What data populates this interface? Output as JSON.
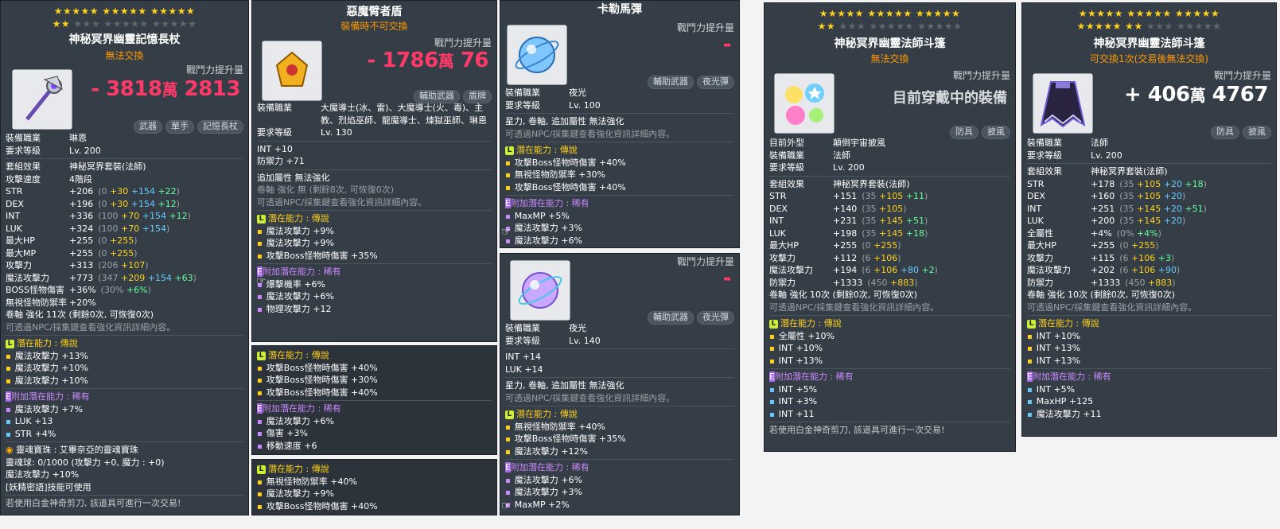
{
  "cp_label": "戰鬥力提升量",
  "p1": {
    "stars_row1": "★★★★★ ★★★★★ ★★★★★",
    "stars_row2_on": "★★",
    "stars_row2_off": "★★★ ★★★★★ ★★★★★",
    "title": "神秘冥界幽靈記憶長杖",
    "sub": "無法交換",
    "cp": "- 3818",
    "cp_wan": "萬",
    "cp_rest": "2813",
    "tags": [
      "武器",
      "單手",
      "記憶長杖"
    ],
    "job_label": "裝備職業",
    "job": "琳恩",
    "req_label": "要求等級",
    "req": "Lv. 200",
    "set_label": "套組效果",
    "set": "神秘冥界套裝(法師)",
    "speed_label": "攻擊速度",
    "speed": "4階段",
    "stats": [
      {
        "k": "STR",
        "v": "+206",
        "b": "(0 ",
        "y": "+30",
        "c": " +154",
        "g": " +22",
        "e": ")"
      },
      {
        "k": "DEX",
        "v": "+196",
        "b": "(0 ",
        "y": "+30",
        "c": " +154",
        "g": " +12",
        "e": ")"
      },
      {
        "k": "INT",
        "v": "+336",
        "b": "(100 ",
        "y": "+70",
        "c": " +154",
        "g": " +12",
        "e": ")"
      },
      {
        "k": "LUK",
        "v": "+324",
        "b": "(100 ",
        "y": "+70",
        "c": " +154",
        "g": "",
        "e": ")"
      },
      {
        "k": "最大HP",
        "v": "+255",
        "b": "(0 ",
        "y": "+255",
        "c": "",
        "g": "",
        "e": ")"
      },
      {
        "k": "最大MP",
        "v": "+255",
        "b": "(0 ",
        "y": "+255",
        "c": "",
        "g": "",
        "e": ")"
      },
      {
        "k": "攻擊力",
        "v": "+313",
        "b": "(206 ",
        "y": "+107",
        "c": "",
        "g": "",
        "e": ")"
      },
      {
        "k": "魔法攻擊力",
        "v": "+773",
        "b": "(347 ",
        "y": "+209",
        "c": " +154",
        "g": " +63",
        "e": ")"
      },
      {
        "k": "BOSS怪物傷害",
        "v": "+36%",
        "b": "(30% ",
        "y": "",
        "c": "",
        "g": "+6%",
        "e": ")"
      },
      {
        "k": "無視怪物防禦率",
        "v": "+20%",
        "b": "",
        "y": "",
        "c": "",
        "g": "",
        "e": ""
      }
    ],
    "scroll": "卷軸 強化 11次 (剩餘0次, 可恢復0次)",
    "npc": "可透過NPC/採集鍵查看強化資訊詳細內容。",
    "pot_title": "潛在能力 : 傳說",
    "pot": [
      "魔法攻擊力 +13%",
      "魔法攻擊力 +10%",
      "魔法攻擊力 +10%"
    ],
    "bonus_title": "附加潛在能力 : 稀有",
    "bonus": [
      "魔法攻擊力 +7%",
      "LUK +13",
      "STR +4%"
    ],
    "soul": "靈魂寶珠 : 艾畢奈亞的靈魂寶珠",
    "soul2": "靈魂球: 0/1000 (攻擊力 +0, 魔力 : +0)",
    "soul3": "魔法攻擊力 +10%",
    "soul4": "[妖精密語]技能可使用",
    "footer": "若使用白金神奇剪刀, 該道具可進行一次交易!"
  },
  "p2": {
    "title": "惡魔臂者盾",
    "sub": "裝備時不可交換",
    "cp": "- 1786",
    "cp_wan": "萬",
    "cp_rest": "76",
    "tags": [
      "輔助武器",
      "盾牌"
    ],
    "job_label": "裝備職業",
    "job": "大魔導士(冰、雷)、大魔導士(火、毒)、主教、烈焰巫師、龍魔導士、煉獄巫師、琳恩",
    "req_label": "要求等級",
    "req": "Lv. 130",
    "stat1": "INT  +10",
    "stat2": "防禦力  +71",
    "extra": "追加屬性 無法強化",
    "scroll": "卷軸 強化 無 (剩餘8次, 可恢復0次)",
    "npc": "可透過NPC/採集鍵查看強化資訊詳細內容。",
    "pot_title": "潛在能力 : 傳說",
    "pot": [
      "魔法攻擊力 +9%",
      "魔法攻擊力 +9%",
      "攻擊Boss怪物時傷害 +35%"
    ],
    "bonus_title": "附加潛在能力 : 稀有",
    "bonus": [
      "爆擊機率 +6%",
      "魔法攻擊力 +6%",
      "物理攻擊力 +12"
    ]
  },
  "p3": {
    "pot_title": "潛在能力 : 傳說",
    "pot": [
      "攻擊Boss怪物時傷害 +40%",
      "攻擊Boss怪物時傷害 +30%",
      "攻擊Boss怪物時傷害 +40%"
    ],
    "bonus_title": "附加潛在能力 : 稀有",
    "bonus": [
      "魔法攻擊力 +6%",
      "傷害 +3%",
      "移動速度 +6"
    ]
  },
  "p4": {
    "pot_title": "潛在能力 : 傳說",
    "pot": [
      "無視怪物防禦率 +40%",
      "魔法攻擊力 +9%",
      "攻擊Boss怪物時傷害 +40%"
    ]
  },
  "p5": {
    "title": "卡勒馬彈",
    "cp": "-",
    "tags": [
      "輔助武器",
      "夜光彈"
    ],
    "job_label": "裝備職業",
    "job": "夜光",
    "req_label": "要求等級",
    "req": "Lv. 100",
    "extra": "星力, 卷軸, 追加屬性 無法強化",
    "npc": "可透過NPC/採集鍵查看強化資訊詳細內容。",
    "pot_title": "潛在能力 : 傳說",
    "pot": [
      "攻擊Boss怪物時傷害 +40%",
      "無視怪物防禦率 +30%",
      "攻擊Boss怪物時傷害 +40%"
    ],
    "bonus_title": "附加潛在能力 : 稀有",
    "bonus": [
      "MaxMP +5%",
      "魔法攻擊力 +3%",
      "魔法攻擊力 +6%"
    ]
  },
  "p6": {
    "cp": "-",
    "tags": [
      "輔助武器",
      "夜光彈"
    ],
    "job_label": "裝備職業",
    "job": "夜光",
    "req_label": "要求等級",
    "req": "Lv. 140",
    "stat1": "INT  +14",
    "stat2": "LUK  +14",
    "extra": "星力, 卷軸, 追加屬性 無法強化",
    "npc": "可透過NPC/採集鍵查看強化資訊詳細內容。",
    "pot_title": "潛在能力 : 傳說",
    "pot": [
      "無視怪物防禦率 +40%",
      "攻擊Boss怪物時傷害 +35%",
      "魔法攻擊力 +12%"
    ],
    "bonus_title": "附加潛在能力 : 稀有",
    "bonus": [
      "魔法攻擊力 +6%",
      "魔法攻擊力 +3%",
      "MaxMP +2%"
    ]
  },
  "p7": {
    "stars_row1": "★★★★★ ★★★★★ ★★★★★",
    "stars_row2_on": "★★",
    "stars_row2_off": "★★★ ★★★★★ ★★★★★",
    "title": "神秘冥界幽靈法師斗篷",
    "sub": "無法交換",
    "cp_text": "目前穿戴中的裝備",
    "tags": [
      "防具",
      "披風"
    ],
    "look_label": "目前外型",
    "look": "顛倒宇宙披風",
    "job_label": "裝備職業",
    "job": "法師",
    "req_label": "要求等級",
    "req": "Lv. 200",
    "set_label": "套組效果",
    "set": "神秘冥界套裝(法師)",
    "stats": [
      {
        "k": "STR",
        "v": "+151",
        "b": "(35 ",
        "y": "+105",
        "c": "",
        "g": " +11",
        "e": ")"
      },
      {
        "k": "DEX",
        "v": "+140",
        "b": "(35 ",
        "y": "+105",
        "c": "",
        "g": "",
        "e": ")"
      },
      {
        "k": "INT",
        "v": "+231",
        "b": "(35 ",
        "y": "+145",
        "c": "",
        "g": " +51",
        "e": ")"
      },
      {
        "k": "LUK",
        "v": "+198",
        "b": "(35 ",
        "y": "+145",
        "c": "",
        "g": " +18",
        "e": ")"
      },
      {
        "k": "最大HP",
        "v": "+255",
        "b": "(0 ",
        "y": "+255",
        "c": "",
        "g": "",
        "e": ")"
      },
      {
        "k": "攻擊力",
        "v": "+112",
        "b": "(6 ",
        "y": "+106",
        "c": "",
        "g": "",
        "e": ")"
      },
      {
        "k": "魔法攻擊力",
        "v": "+194",
        "b": "(6 ",
        "y": "+106",
        "c": " +80",
        "g": " +2",
        "e": ")"
      },
      {
        "k": "防禦力",
        "v": "+1333",
        "b": "(450 ",
        "y": "+883",
        "c": "",
        "g": "",
        "e": ")"
      }
    ],
    "scroll": "卷軸 強化 10次 (剩餘0次, 可恢復0次)",
    "npc": "可透過NPC/採集鍵查看強化資訊詳細內容。",
    "pot_title": "潛在能力 : 傳說",
    "pot": [
      "全屬性 +10%",
      "INT +10%",
      "INT +13%"
    ],
    "bonus_title": "附加潛在能力 : 稀有",
    "bonus": [
      "INT +5%",
      "INT +3%",
      "INT +11"
    ],
    "footer": "若使用白金神奇剪刀, 該道具可進行一次交易!"
  },
  "p8": {
    "stars_row1": "★★★★★ ★★★★★ ★★★★★",
    "stars_row2_on": "★★★★★ ★★",
    "stars_row2_off": "★★★ ★★★★★",
    "title": "神秘冥界幽靈法師斗篷",
    "sub": "可交換1次(交易後無法交換)",
    "cp": "+ 406",
    "cp_wan": "萬",
    "cp_rest": "4767",
    "tags": [
      "防具",
      "披風"
    ],
    "job_label": "裝備職業",
    "job": "法師",
    "req_label": "要求等級",
    "req": "Lv. 200",
    "set_label": "套組效果",
    "set": "神秘冥界套裝(法師)",
    "stats": [
      {
        "k": "STR",
        "v": "+178",
        "b": "(35 ",
        "y": "+105",
        "c": " +20",
        "g": " +18",
        "e": ")"
      },
      {
        "k": "DEX",
        "v": "+160",
        "b": "(35 ",
        "y": "+105",
        "c": " +20",
        "g": "",
        "e": ")"
      },
      {
        "k": "INT",
        "v": "+251",
        "b": "(35 ",
        "y": "+145",
        "c": " +20",
        "g": " +51",
        "e": ")"
      },
      {
        "k": "LUK",
        "v": "+200",
        "b": "(35 ",
        "y": "+145",
        "c": " +20",
        "g": "",
        "e": ")"
      },
      {
        "k": "全屬性",
        "v": "+4%",
        "b": "(0% ",
        "y": "",
        "c": "",
        "g": "+4%",
        "e": ")"
      },
      {
        "k": "最大HP",
        "v": "+255",
        "b": "(0 ",
        "y": "+255",
        "c": "",
        "g": "",
        "e": ")"
      },
      {
        "k": "攻擊力",
        "v": "+115",
        "b": "(6 ",
        "y": "+106",
        "c": "",
        "g": " +3",
        "e": ")"
      },
      {
        "k": "魔法攻擊力",
        "v": "+202",
        "b": "(6 ",
        "y": "+106",
        "c": " +90",
        "g": "",
        "e": ")"
      },
      {
        "k": "防禦力",
        "v": "+1333",
        "b": "(450 ",
        "y": "+883",
        "c": "",
        "g": "",
        "e": ")"
      }
    ],
    "scroll": "卷軸 強化 10次 (剩餘0次, 可恢復0次)",
    "npc": "可透過NPC/採集鍵查看強化資訊詳細內容。",
    "pot_title": "潛在能力 : 傳說",
    "pot": [
      "INT +10%",
      "INT +13%",
      "INT +13%"
    ],
    "bonus_title": "附加潛在能力 : 稀有",
    "bonus": [
      "INT +5%",
      "MaxHP +125",
      "魔法攻擊力 +11"
    ]
  }
}
